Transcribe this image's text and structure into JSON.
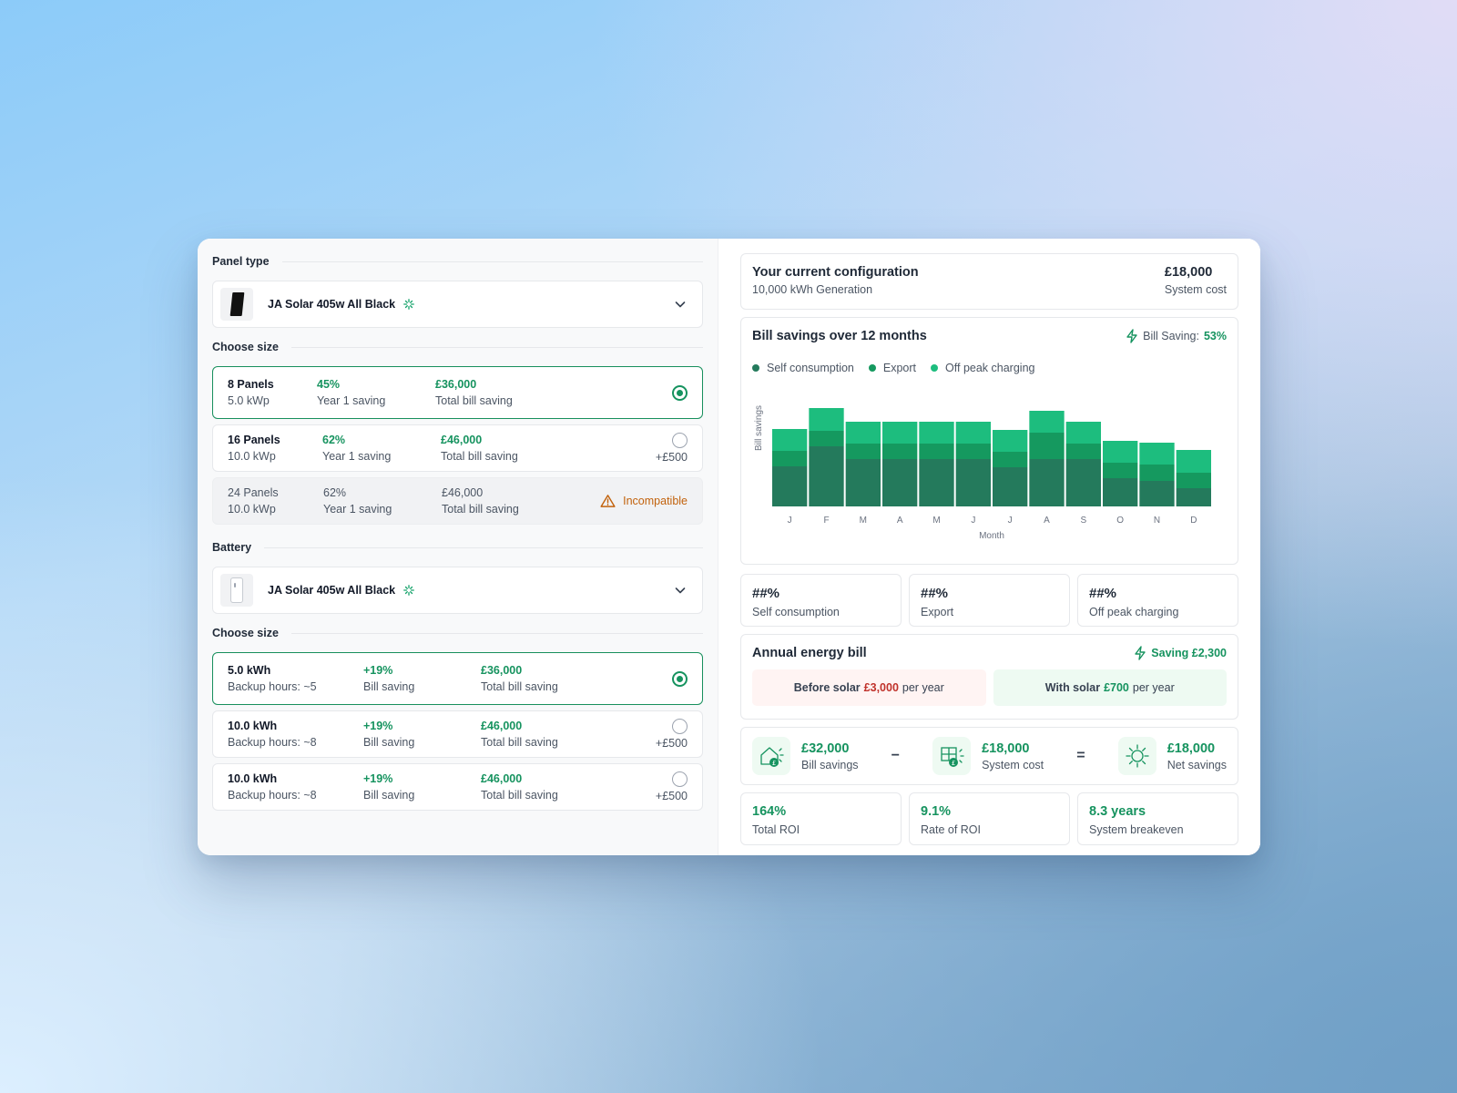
{
  "panel_section": {
    "title": "Panel type",
    "selected_panel": "JA Solar 405w All Black",
    "choose_size_title": "Choose size",
    "options": [
      {
        "size": "8 Panels",
        "kwp": "5.0 kWp",
        "year1": "45%",
        "year1_label": "Year 1 saving",
        "total": "£36,000",
        "total_label": "Total bill saving",
        "state": "selected"
      },
      {
        "size": "16 Panels",
        "kwp": "10.0 kWp",
        "year1": "62%",
        "year1_label": "Year 1 saving",
        "total": "£46,000",
        "total_label": "Total bill saving",
        "extra": "+£500",
        "state": "available"
      },
      {
        "size": "24 Panels",
        "kwp": "10.0 kWp",
        "year1": "62%",
        "year1_label": "Year 1 saving",
        "total": "£46,000",
        "total_label": "Total bill saving",
        "status": "Incompatible",
        "state": "disabled"
      }
    ]
  },
  "battery_section": {
    "title": "Battery",
    "selected_battery": "JA Solar 405w All Black",
    "choose_size_title": "Choose size",
    "options": [
      {
        "size": "5.0 kWh",
        "backup": "Backup hours: ~5",
        "bill": "+19%",
        "bill_label": "Bill saving",
        "total": "£36,000",
        "total_label": "Total bill saving",
        "state": "selected"
      },
      {
        "size": "10.0 kWh",
        "backup": "Backup hours: ~8",
        "bill": "+19%",
        "bill_label": "Bill saving",
        "total": "£46,000",
        "total_label": "Total bill saving",
        "extra": "+£500",
        "state": "available"
      },
      {
        "size": "10.0 kWh",
        "backup": "Backup hours: ~8",
        "bill": "+19%",
        "bill_label": "Bill saving",
        "total": "£46,000",
        "total_label": "Total bill saving",
        "extra": "+£500",
        "state": "available"
      }
    ]
  },
  "config": {
    "title": "Your current configuration",
    "generation": "10,000 kWh Generation",
    "cost": "£18,000",
    "cost_label": "System cost"
  },
  "savings_chart": {
    "title": "Bill savings over 12 months",
    "bill_saving_label": "Bill Saving:",
    "bill_saving_pct": "53%"
  },
  "chart_data": {
    "type": "bar",
    "stacked": true,
    "xlabel": "Month",
    "ylabel": "Bill savings",
    "categories": [
      "J",
      "F",
      "M",
      "A",
      "M",
      "J",
      "J",
      "A",
      "S",
      "O",
      "N",
      "D"
    ],
    "series": [
      {
        "name": "Self consumption",
        "color": "#247a5c",
        "values": [
          44,
          66,
          52,
          52,
          52,
          52,
          43,
          52,
          52,
          31,
          28,
          20
        ]
      },
      {
        "name": "Export",
        "color": "#15995f",
        "values": [
          17,
          17,
          17,
          17,
          17,
          17,
          17,
          29,
          17,
          17,
          18,
          17
        ]
      },
      {
        "name": "Off peak charging",
        "color": "#1dbd7e",
        "values": [
          24,
          25,
          24,
          24,
          24,
          24,
          24,
          24,
          24,
          24,
          24,
          25
        ]
      }
    ],
    "ylim": [
      0,
      110
    ],
    "grid": false,
    "legend_position": "top-left"
  },
  "breakdown": [
    {
      "value": "##%",
      "label": "Self consumption"
    },
    {
      "value": "##%",
      "label": "Export"
    },
    {
      "value": "##%",
      "label": "Off peak charging"
    }
  ],
  "annual_bill": {
    "title": "Annual energy bill",
    "saving": "Saving £2,300",
    "before_label": "Before solar",
    "before_amount": "£3,000",
    "before_suffix": "per year",
    "after_label": "With solar",
    "after_amount": "£700",
    "after_suffix": "per year"
  },
  "equation": {
    "bill_savings": "£32,000",
    "bill_savings_label": "Bill savings",
    "minus": "−",
    "system_cost": "£18,000",
    "system_cost_label": "System cost",
    "equals": "=",
    "net_savings": "£18,000",
    "net_savings_label": "Net savings"
  },
  "roi": [
    {
      "value": "164%",
      "label": "Total ROI"
    },
    {
      "value": "9.1%",
      "label": "Rate of ROI"
    },
    {
      "value": "8.3 years",
      "label": "System breakeven"
    }
  ],
  "colors": {
    "accent": "#16935f",
    "warning": "#c2620c",
    "danger": "#c0322b"
  },
  "icons": [
    "sparkle-icon",
    "chevron-down-icon",
    "radio-icon",
    "warning-icon",
    "lightning-icon",
    "house-pound-icon",
    "panel-pound-icon",
    "sun-icon"
  ]
}
